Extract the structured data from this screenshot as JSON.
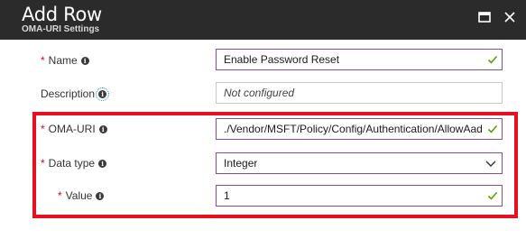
{
  "header": {
    "title": "Add Row",
    "subtitle": "OMA-URI Settings"
  },
  "form": {
    "name": {
      "label": "Name",
      "required_mark": "*",
      "value": "Enable Password Reset"
    },
    "description": {
      "label": "Description",
      "placeholder": "Not configured"
    },
    "oma_uri": {
      "label": "OMA-URI",
      "required_mark": "*",
      "value": "./Vendor/MSFT/Policy/Config/Authentication/AllowAadPasswordReset"
    },
    "data_type": {
      "label": "Data type",
      "required_mark": "*",
      "value": "Integer"
    },
    "value": {
      "label": "Value",
      "required_mark": "*",
      "value": "1"
    }
  },
  "icons": {
    "info": "i",
    "valid": "check-icon",
    "dropdown": "chevron-down-icon",
    "maximize": "maximize-icon",
    "close": "close-icon"
  },
  "colors": {
    "header_bg": "#2b2b2b",
    "required": "#e0001a",
    "field_border_active": "#8a4c98",
    "valid_check": "#57a300",
    "highlight_box": "#e8101e"
  }
}
